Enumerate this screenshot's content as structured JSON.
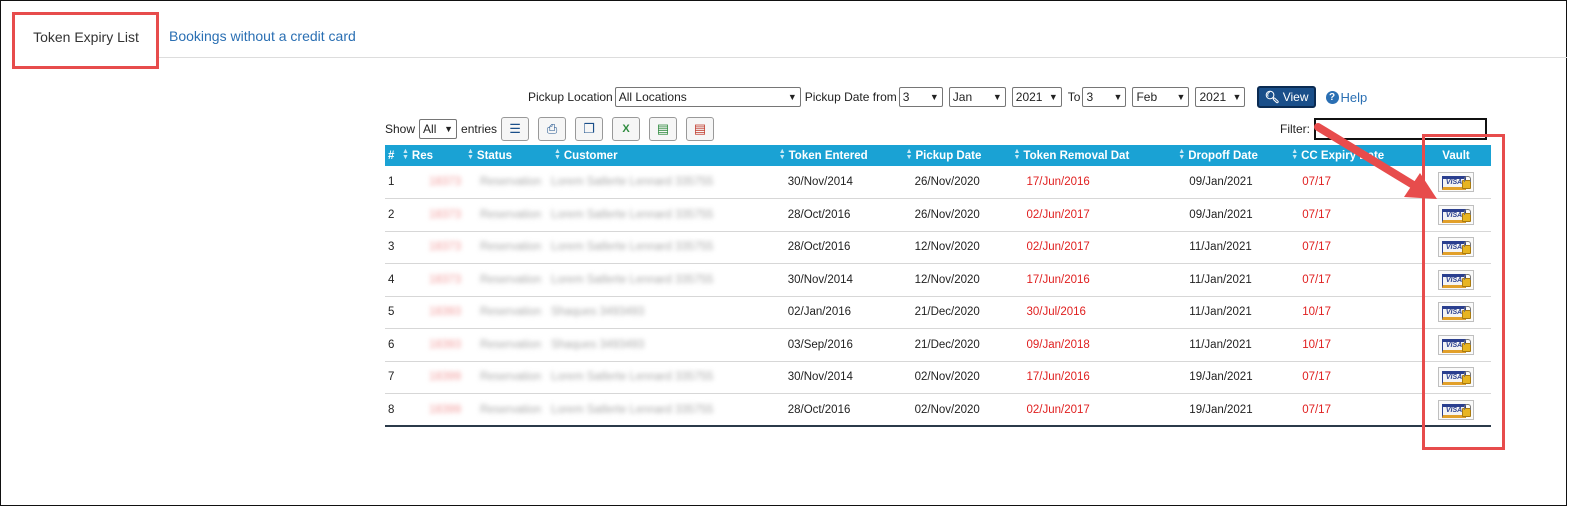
{
  "tabs": {
    "active": "Token Expiry List",
    "other": "Bookings without a credit card"
  },
  "filters": {
    "pickup_location_label": "Pickup Location",
    "pickup_location_value": "All Locations",
    "pickup_date_from_label": "Pickup Date from",
    "from_day": "3",
    "from_month": "Jan",
    "from_year": "2021",
    "to_label": "To",
    "to_day": "3",
    "to_month": "Feb",
    "to_year": "2021",
    "view_label": "View",
    "help_label": "Help"
  },
  "toolbar": {
    "show_label": "Show",
    "show_value": "All",
    "entries_label": "entries",
    "filter_label": "Filter:"
  },
  "table": {
    "columns": [
      "#",
      "Res",
      "Status",
      "Customer",
      "Token Entered",
      "Pickup Date",
      "Token Removal Dat",
      "Dropoff Date",
      "CC Expiry Date",
      "Vault"
    ],
    "rows": [
      {
        "n": "1",
        "res": "18373",
        "status": "Reservation",
        "customer": "Lorem Satlerte Lennard 335755",
        "token_entered": "30/Nov/2014",
        "pickup": "26/Nov/2020",
        "removal": "17/Jun/2016",
        "dropoff": "09/Jan/2021",
        "cc_expiry": "07/17"
      },
      {
        "n": "2",
        "res": "18373",
        "status": "Reservation",
        "customer": "Lorem Satlerte Lennard 335755",
        "token_entered": "28/Oct/2016",
        "pickup": "26/Nov/2020",
        "removal": "02/Jun/2017",
        "dropoff": "09/Jan/2021",
        "cc_expiry": "07/17"
      },
      {
        "n": "3",
        "res": "18373",
        "status": "Reservation",
        "customer": "Lorem Satlerte Lennard 335755",
        "token_entered": "28/Oct/2016",
        "pickup": "12/Nov/2020",
        "removal": "02/Jun/2017",
        "dropoff": "11/Jan/2021",
        "cc_expiry": "07/17"
      },
      {
        "n": "4",
        "res": "18373",
        "status": "Reservation",
        "customer": "Lorem Satlerte Lennard 335755",
        "token_entered": "30/Nov/2014",
        "pickup": "12/Nov/2020",
        "removal": "17/Jun/2016",
        "dropoff": "11/Jan/2021",
        "cc_expiry": "07/17"
      },
      {
        "n": "5",
        "res": "18393",
        "status": "Reservation",
        "customer": "Shaques 3493493",
        "token_entered": "02/Jan/2016",
        "pickup": "21/Dec/2020",
        "removal": "30/Jul/2016",
        "dropoff": "11/Jan/2021",
        "cc_expiry": "10/17"
      },
      {
        "n": "6",
        "res": "18393",
        "status": "Reservation",
        "customer": "Shaques 3493493",
        "token_entered": "03/Sep/2016",
        "pickup": "21/Dec/2020",
        "removal": "09/Jan/2018",
        "dropoff": "11/Jan/2021",
        "cc_expiry": "10/17"
      },
      {
        "n": "7",
        "res": "18399",
        "status": "Reservation",
        "customer": "Lorem Satlerte Lennard 335755",
        "token_entered": "30/Nov/2014",
        "pickup": "02/Nov/2020",
        "removal": "17/Jun/2016",
        "dropoff": "19/Jan/2021",
        "cc_expiry": "07/17"
      },
      {
        "n": "8",
        "res": "18399",
        "status": "Reservation",
        "customer": "Lorem Satlerte Lennard 335755",
        "token_entered": "28/Oct/2016",
        "pickup": "02/Nov/2020",
        "removal": "02/Jun/2017",
        "dropoff": "19/Jan/2021",
        "cc_expiry": "07/17"
      }
    ]
  },
  "vault_icon": "visa-vault-icon",
  "colors": {
    "header_bg": "#1aa2d4",
    "highlight": "#e74c4c",
    "link": "#2a6fb3",
    "date_red": "#e02020"
  }
}
